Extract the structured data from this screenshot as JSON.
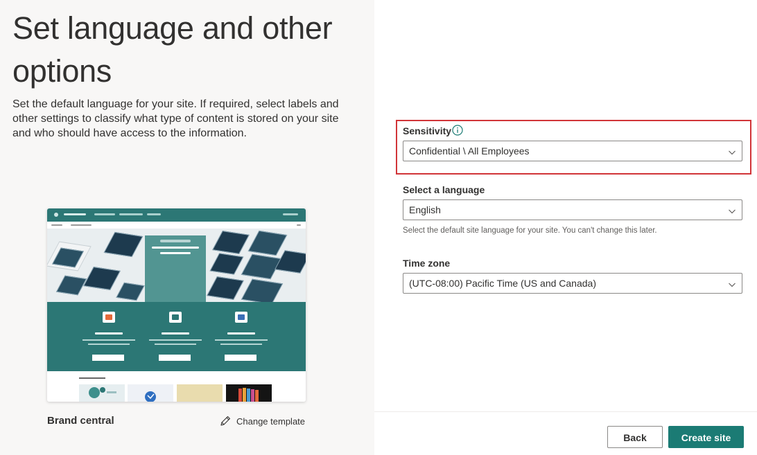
{
  "page": {
    "title": "Set language and other options",
    "description": "Set the default language for your site. If required, select labels and other settings to classify what type of content is stored on your site and who should have access to the information."
  },
  "template": {
    "name": "Brand central",
    "change_label": "Change template"
  },
  "sensitivity": {
    "label": "Sensitivity",
    "value": "Confidential \\ All Employees"
  },
  "language": {
    "label": "Select a language",
    "value": "English",
    "hint": "Select the default site language for your site. You can't change this later."
  },
  "timezone": {
    "label": "Time zone",
    "value": "(UTC-08:00) Pacific Time (US and Canada)"
  },
  "actions": {
    "back_label": "Back",
    "create_label": "Create site"
  },
  "colors": {
    "accent": "#1b7b74",
    "highlight": "#d13438",
    "left_panel_bg": "#f8f7f6"
  },
  "icons": {
    "info": "info-icon",
    "chevron": "chevron-down-icon",
    "edit": "pencil-icon"
  }
}
